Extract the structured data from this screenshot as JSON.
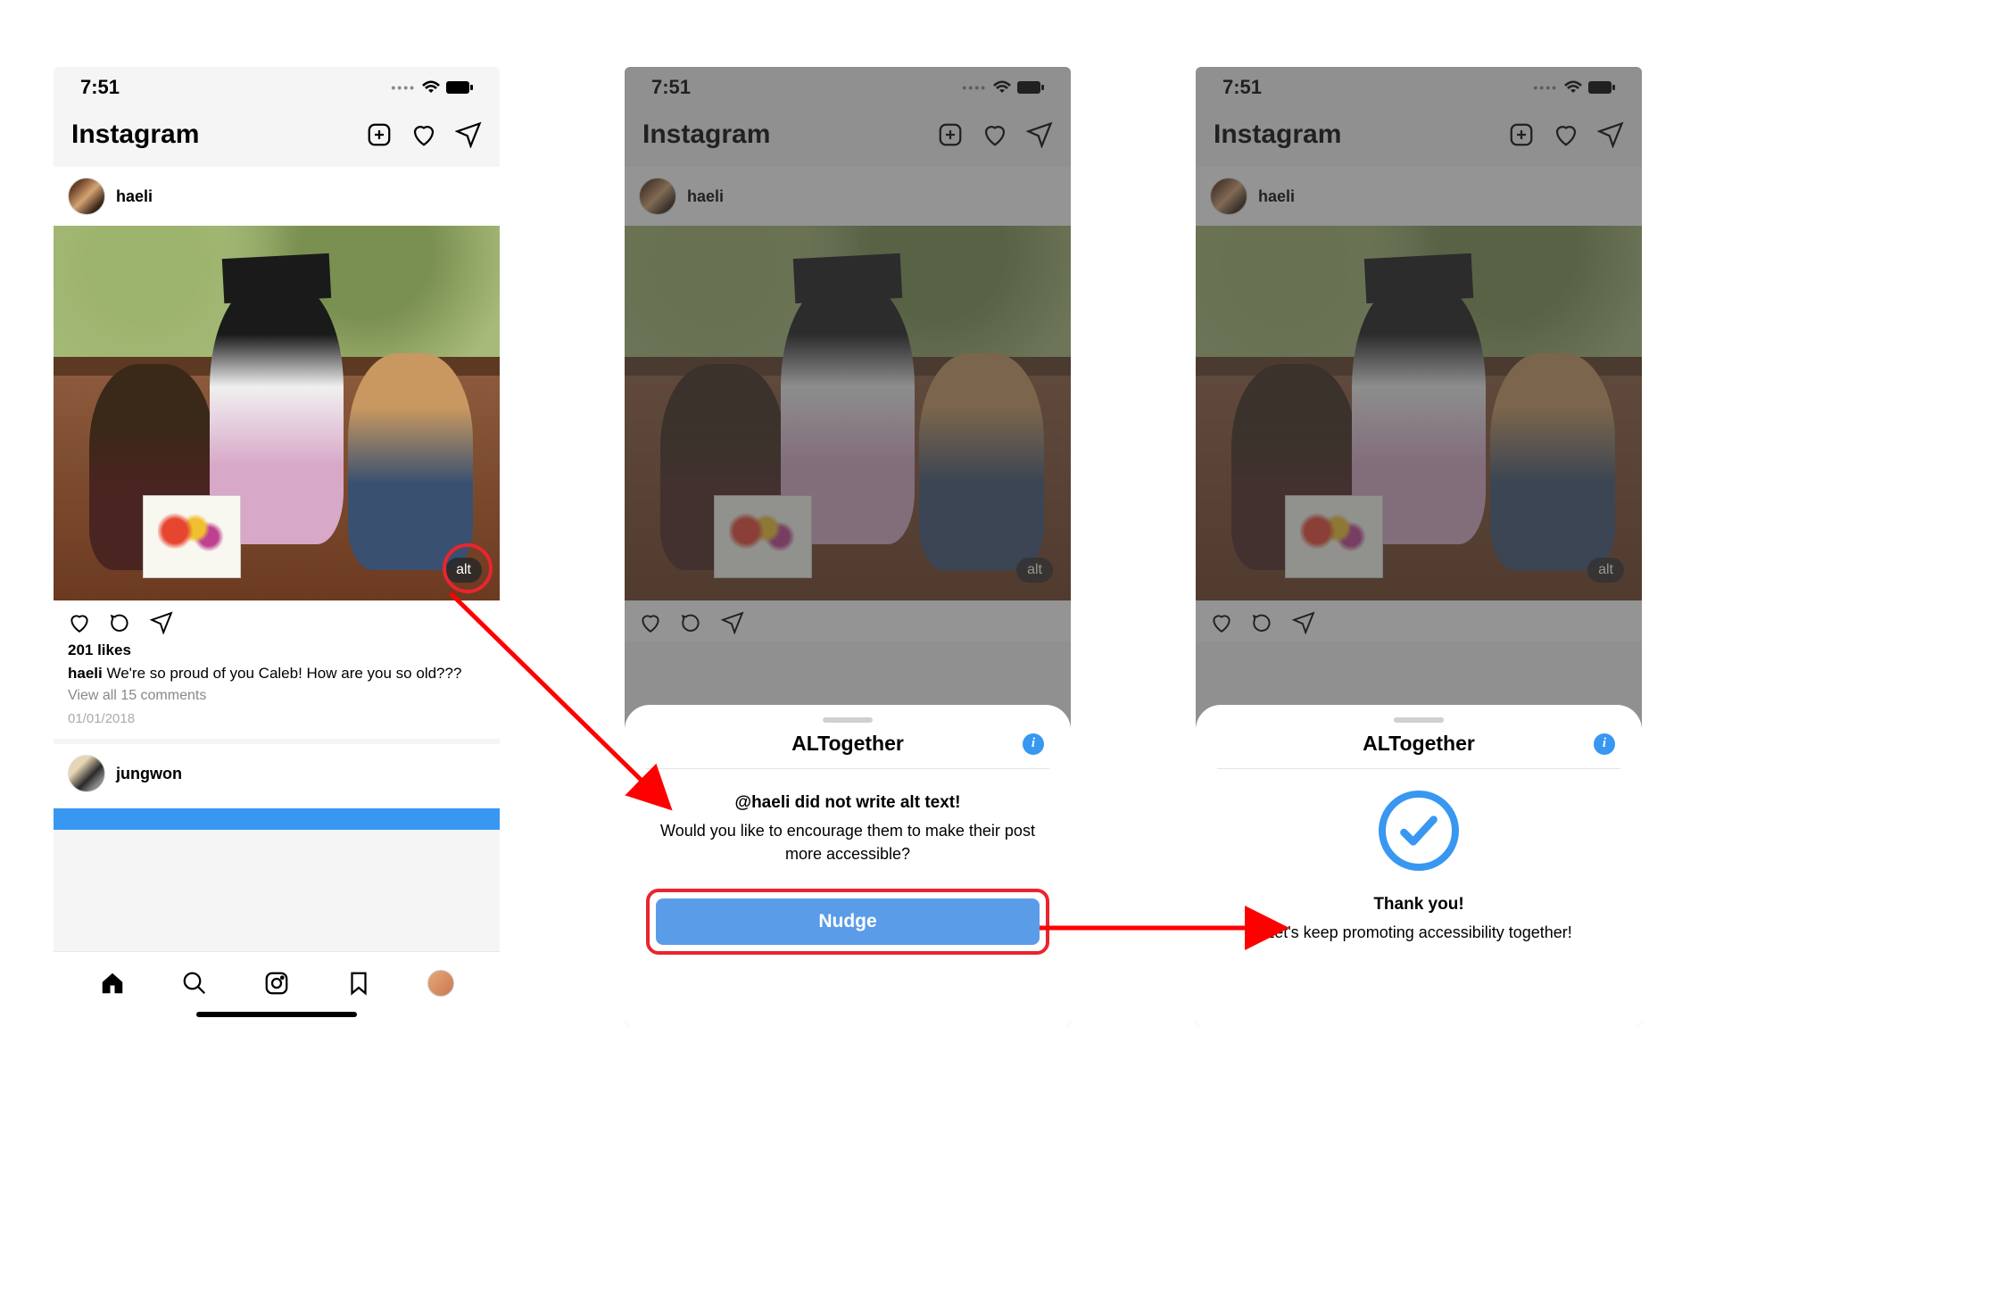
{
  "status": {
    "time": "7:51"
  },
  "app": {
    "name": "Instagram"
  },
  "post": {
    "username": "haeli",
    "alt_badge": "alt",
    "likes": "201 likes",
    "caption_user": "haeli",
    "caption_text": " We're so proud of you Caleb! How are you so old???",
    "comments_link": "View all 15 comments",
    "date": "01/01/2018"
  },
  "next_post": {
    "username": "jungwon"
  },
  "sheet": {
    "title": "ALTogether",
    "nudge_heading": "@haeli did not write alt text!",
    "nudge_body": "Would you like to encourage them to make their post more accessible?",
    "nudge_button": "Nudge",
    "thanks_heading": "Thank you!",
    "thanks_body": "Let's keep promoting accessibility together!"
  }
}
